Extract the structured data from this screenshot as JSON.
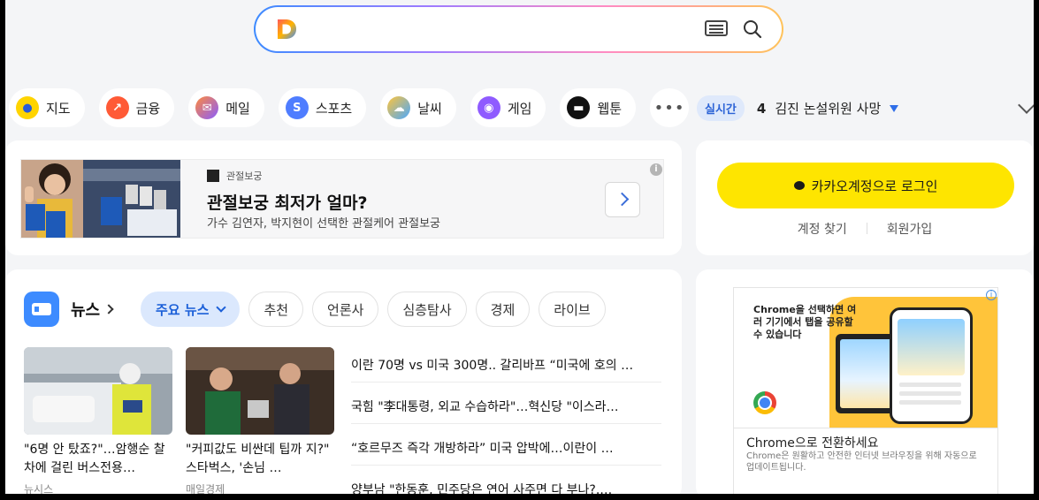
{
  "search": {
    "placeholder": ""
  },
  "quick_nav": [
    {
      "label": "지도",
      "icon": "map-pin-icon",
      "color": "#ffd400"
    },
    {
      "label": "금융",
      "icon": "finance-chart-icon",
      "color": "#ff5a36"
    },
    {
      "label": "메일",
      "icon": "mail-icon",
      "color": "#8a5cff"
    },
    {
      "label": "스포츠",
      "icon": "sports-icon",
      "color": "#4f7dff"
    },
    {
      "label": "날씨",
      "icon": "weather-icon",
      "color": "#4aa8ff"
    },
    {
      "label": "게임",
      "icon": "game-icon",
      "color": "#8f5bff"
    },
    {
      "label": "웹툰",
      "icon": "webtoon-icon",
      "color": "#111111"
    }
  ],
  "more_label": "•••",
  "realtime": {
    "badge": "실시간",
    "rank": "4",
    "keyword": "김진 논설위원 사망"
  },
  "ad": {
    "brand": "관절보궁",
    "title": "관절보궁 최저가 얼마?",
    "desc": "가수 김연자, 박지현이 선택한 관절케어 관절보궁",
    "info": "i"
  },
  "login": {
    "kakao_label": "카카오계정으로 로그인",
    "find_account": "계정 찾기",
    "signup": "회원가입"
  },
  "news": {
    "title": "뉴스",
    "tabs": [
      "주요 뉴스",
      "추천",
      "언론사",
      "심층탐사",
      "경제",
      "라이브"
    ],
    "thumbs": [
      {
        "caption": "\"6명 안 탔죠?\"…암행순 찰차에 걸린 버스전용…",
        "source": "뉴시스"
      },
      {
        "caption": "\"커피값도 비싼데 팁까 지?\" 스타벅스, '손님 …",
        "source": "매일경제"
      }
    ],
    "headlines": [
      "이란 70명 vs 미국 300명.. 갈리바프 “미국에 호의 …",
      "국힘 \"李대통령, 외교 수습하라\"…혁신당 \"이스라…",
      "“호르무즈 즉각 개방하라” 미국 압박에…이란이 …",
      "양부남 \"한동훈, 민주당은 연어 사주면 다 부나?.…"
    ]
  },
  "chrome_ad": {
    "headline_lines": "Chrome을 선택하면 여러 기기에서 탭을 공유할 수 있습니다",
    "title": "Chrome으로 전환하세요",
    "sub": "Chrome은 원활하고 안전한 인터넷 브라우징을 위해 자동으로 업데이트됩니다.",
    "info": "i"
  }
}
